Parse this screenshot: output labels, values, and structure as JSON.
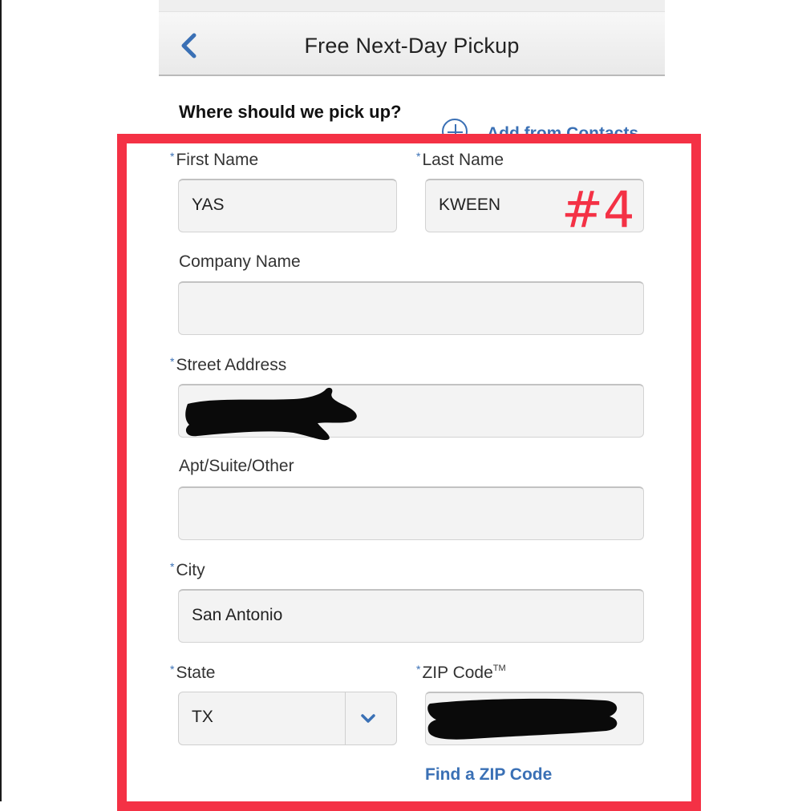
{
  "header": {
    "title": "Free Next-Day Pickup",
    "back_icon": "chevron-left-icon"
  },
  "section": {
    "title": "Where should we pick up?",
    "add_contacts_label": "Add from Contacts",
    "add_contacts_icon": "plus-circle-icon"
  },
  "annotation": {
    "text": "#4",
    "color": "#f43145"
  },
  "form": {
    "required_marker": "*",
    "first_name": {
      "label": "First Name",
      "value": "YAS",
      "required": true
    },
    "last_name": {
      "label": "Last Name",
      "value": "KWEEN",
      "required": true
    },
    "company": {
      "label": "Company Name",
      "value": "",
      "required": false
    },
    "street": {
      "label": "Street Address",
      "value": "",
      "required": true,
      "redacted": true
    },
    "apt": {
      "label": "Apt/Suite/Other",
      "value": "",
      "required": false
    },
    "city": {
      "label": "City",
      "value": "San Antonio",
      "required": true
    },
    "state": {
      "label": "State",
      "value": "TX",
      "required": true,
      "icon": "chevron-down-icon"
    },
    "zip": {
      "label": "ZIP Code",
      "trademark": "TM",
      "value": "",
      "required": true,
      "redacted": true
    },
    "find_zip_label": "Find a ZIP Code"
  },
  "colors": {
    "accent": "#3a70b5",
    "frame": "#f43145",
    "field_bg": "#f3f3f3"
  }
}
